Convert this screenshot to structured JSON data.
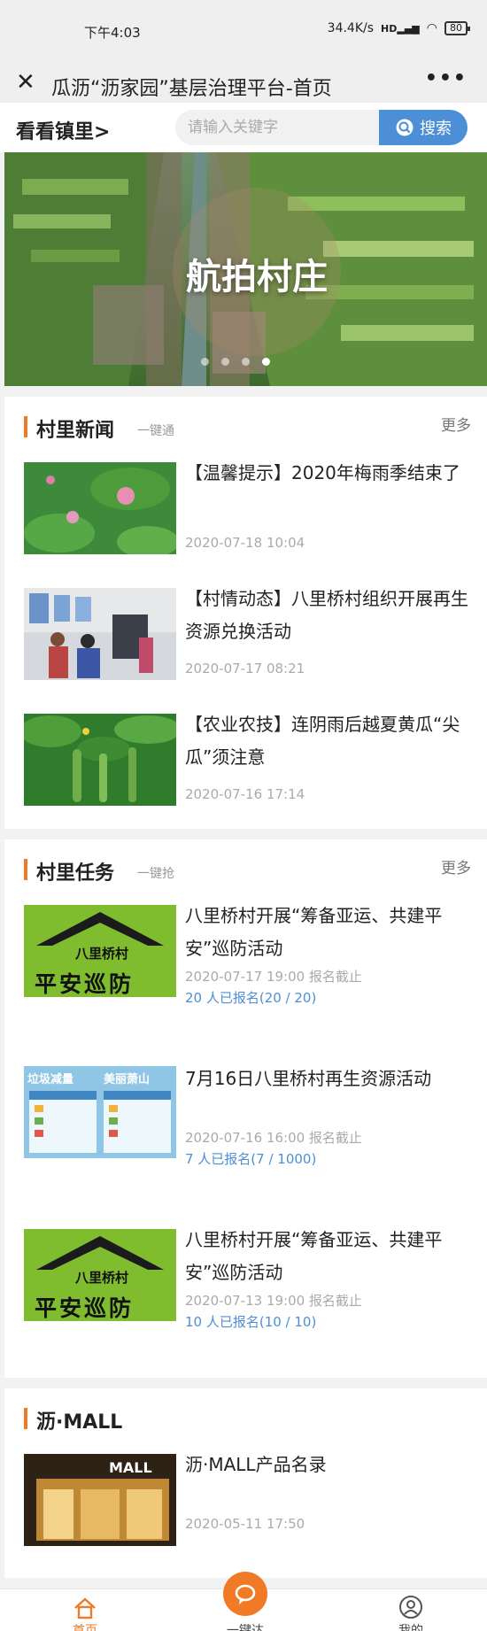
{
  "status": {
    "time": "下午4:03",
    "speed": "34.4K/s",
    "network": "HD",
    "battery": "80"
  },
  "nav": {
    "title": "瓜沥“沥家园”基层治理平台-首页"
  },
  "search": {
    "town_link": "看看镇里",
    "placeholder": "请输入关键字",
    "button_label": "搜索"
  },
  "banner": {
    "caption": "航拍村庄",
    "dot_count": 4,
    "active_dot": 3
  },
  "news": {
    "title": "村里新闻",
    "subtitle": "一键通",
    "more": "更多",
    "items": [
      {
        "title": "【温馨提示】2020年梅雨季结束了",
        "date": "2020-07-18 10:04",
        "icon": "lotus-photo"
      },
      {
        "title": "【村情动态】八里桥村组织开展再生资源兑换活动",
        "date": "2020-07-17 08:21",
        "icon": "recycling-event-photo"
      },
      {
        "title": "【农业农技】连阴雨后越夏黄瓜“尖瓜”须注意",
        "date": "2020-07-16 17:14",
        "icon": "cucumber-photo"
      }
    ]
  },
  "tasks": {
    "title": "村里任务",
    "subtitle": "一键抢",
    "more": "更多",
    "items": [
      {
        "title": "八里桥村开展“筹备亚运、共建平安”巡防活动",
        "date": "2020-07-17 19:00 报名截止",
        "signup": "20 人已报名(20 / 20)",
        "poster_village": "八里桥村",
        "poster_slogan": "平安巡防"
      },
      {
        "title": "7月16日八里桥村再生资源活动",
        "date": "2020-07-16 16:00 报名截止",
        "signup": "7 人已报名(7 / 1000)",
        "poster_left": "垃圾减量",
        "poster_right": "美丽萧山"
      },
      {
        "title": "八里桥村开展“筹备亚运、共建平安”巡防活动",
        "date": "2020-07-13 19:00 报名截止",
        "signup": "10 人已报名(10 / 10)",
        "poster_village": "八里桥村",
        "poster_slogan": "平安巡防"
      }
    ]
  },
  "mall": {
    "title": "沥·MALL",
    "items": [
      {
        "title": "沥·MALL产品名录",
        "date": "2020-05-11 17:50",
        "store_sign": "MALL"
      }
    ]
  },
  "bottom_nav": {
    "home": "首页",
    "center": "一键达",
    "mine": "我的"
  },
  "colors": {
    "accent": "#f07a26",
    "link_blue": "#4d8fd6"
  }
}
